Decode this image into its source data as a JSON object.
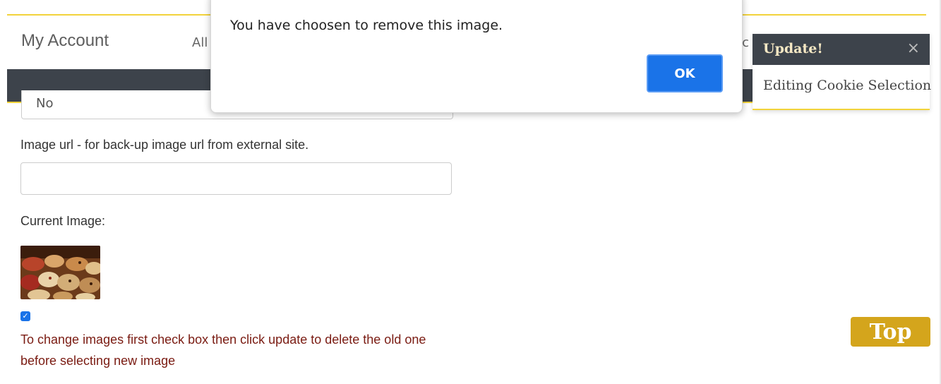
{
  "header": {
    "brand": "My Account",
    "nav_all": "All",
    "nav_partial": "ec"
  },
  "form": {
    "prev_input_value": "No",
    "image_url_label": "Image url - for back-up image url from external site.",
    "image_url_value": "",
    "current_image_label": "Current Image:",
    "checkbox_checked": true,
    "change_note": "To change images first check box then click update to delete the old one before selecting new image"
  },
  "dialog": {
    "message": "You have choosen to remove this image.",
    "ok_label": "OK"
  },
  "toast": {
    "title": "Update!",
    "close": "×",
    "body": "Editing Cookie Selection"
  },
  "top_button": {
    "label": "Top"
  },
  "colors": {
    "accent_yellow": "#f2d33b",
    "nav_dark": "#3d434b",
    "ok_blue": "#1a73e8",
    "note_red": "#7a1b12",
    "top_gold": "#d4a51c"
  }
}
